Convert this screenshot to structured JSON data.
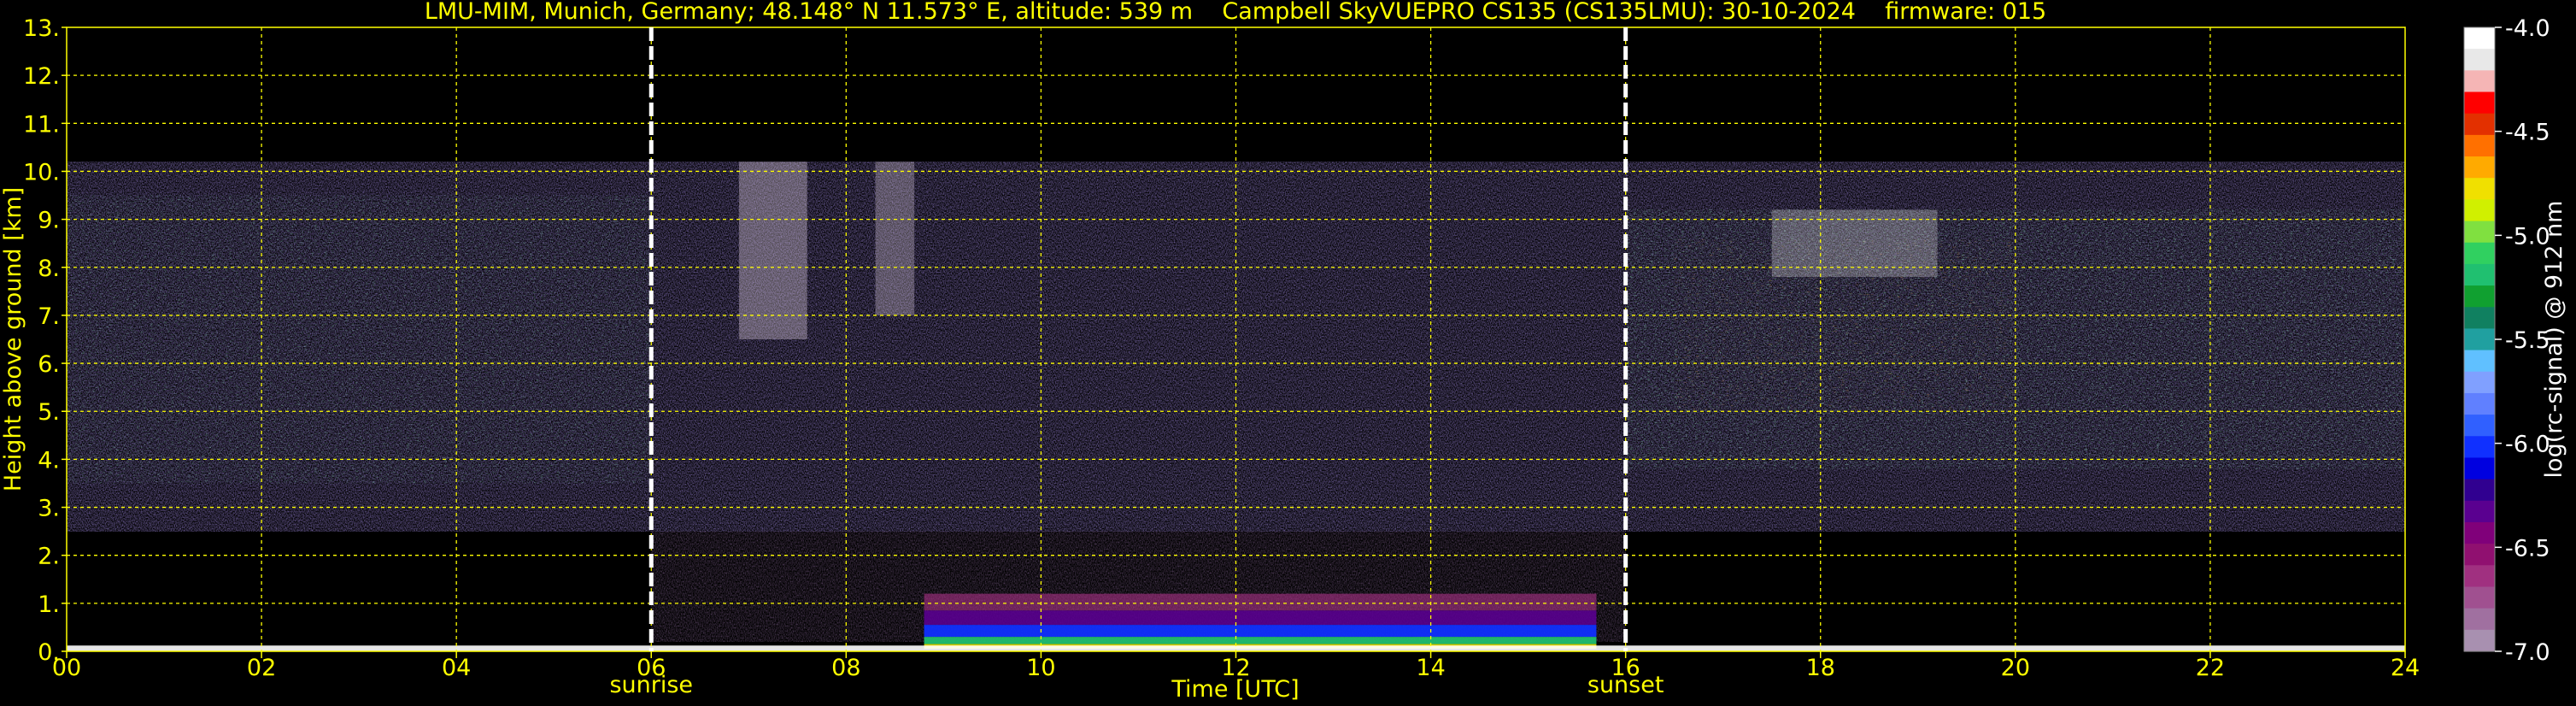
{
  "chart_data": {
    "type": "heatmap",
    "title": "LMU-MIM, Munich, Germany; 48.148° N 11.573° E, altitude: 539 m    Campbell SkyVUEPRO CS135 (CS135LMU): 30-10-2024    firmware: 015",
    "xlabel": "Time [UTC]",
    "ylabel": "Height above ground [km]",
    "xlim": [
      0,
      24
    ],
    "ylim": [
      0,
      13
    ],
    "x_ticks": [
      "00",
      "02",
      "04",
      "06",
      "08",
      "10",
      "12",
      "14",
      "16",
      "18",
      "20",
      "22",
      "24"
    ],
    "y_ticks": [
      "0.",
      "1.",
      "2.",
      "3.",
      "4.",
      "5.",
      "6.",
      "7.",
      "8.",
      "9.",
      "10.",
      "11.",
      "12.",
      "13."
    ],
    "grid": true,
    "grid_color": "#ffff00",
    "markers": [
      {
        "x": 6.0,
        "label": "sunrise"
      },
      {
        "x": 16.0,
        "label": "sunset"
      }
    ],
    "colorbar": {
      "label": "log(rc-signal) @ 912 nm",
      "range": [
        -7.0,
        -4.0
      ],
      "ticks": [
        "-4.0",
        "-4.5",
        "-5.0",
        "-5.5",
        "-6.0",
        "-6.5",
        "-7.0"
      ],
      "colors": [
        "#ffffff",
        "#e8e8e8",
        "#f5b5b5",
        "#ff0000",
        "#e33000",
        "#ff7000",
        "#ffaa00",
        "#f0e000",
        "#d0f000",
        "#80e040",
        "#30d060",
        "#20c070",
        "#10a030",
        "#108060",
        "#20a0a0",
        "#60c0ff",
        "#80a0ff",
        "#6080ff",
        "#3060ff",
        "#1030ff",
        "#0000e0",
        "#300090",
        "#5a0090",
        "#80007a",
        "#901070",
        "#a03080",
        "#a05090",
        "#a070a0",
        "#a890b0"
      ]
    },
    "backscatter_regions": [
      {
        "name": "high cloud layer",
        "x_range": [
          0,
          24
        ],
        "height_km": [
          2.5,
          10.2
        ]
      },
      {
        "name": "boundary layer",
        "x_range": [
          8.8,
          15.7
        ],
        "height_km": [
          0,
          1.2
        ]
      }
    ]
  },
  "colors": {
    "background": "#000000",
    "text": "#ffff00",
    "colorbar_text": "#ffffff"
  }
}
